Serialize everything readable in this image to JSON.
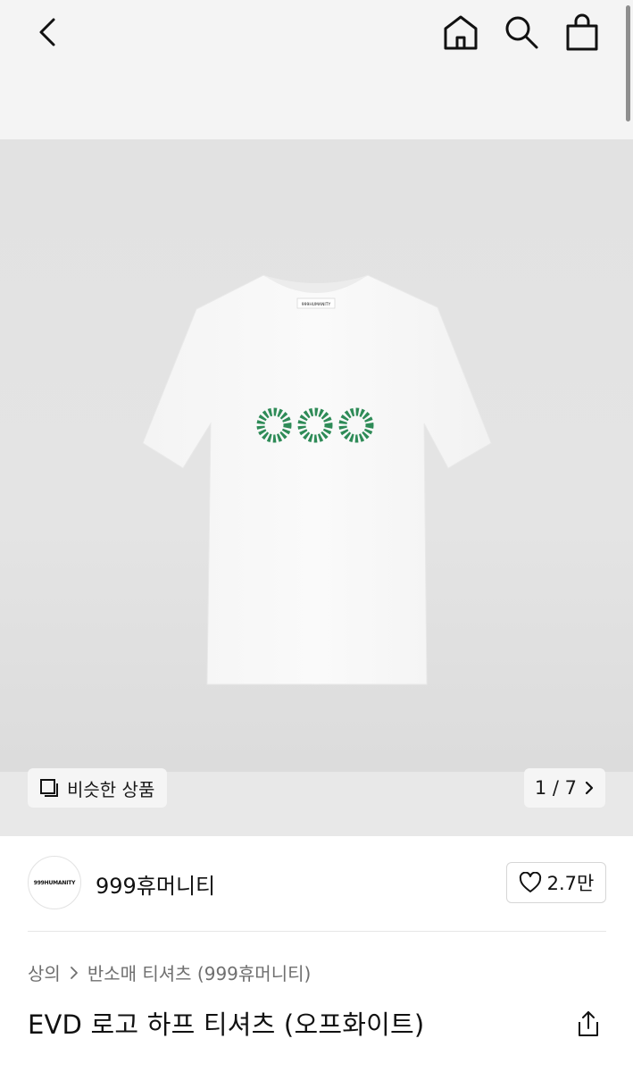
{
  "header": {
    "icons": [
      "chevron-left-icon",
      "home-icon",
      "search-icon",
      "shopping-bag-icon"
    ]
  },
  "gallery": {
    "similar_label": "비슷한 상품",
    "counter": "1 / 7",
    "shirt_tag_text": "999HUMANITY"
  },
  "brand": {
    "logo_text": "999HUMANITY",
    "name": "999휴머니티",
    "likes": "2.7만"
  },
  "breadcrumb": {
    "category": "상의",
    "subcategory": "반소매 티셔츠 (999휴머니티)"
  },
  "product": {
    "title": "EVD 로고 하프 티셔츠 (오프화이트)"
  },
  "colors": {
    "header_bg": "#f4f4f4",
    "emblem_green": "#2e8b57",
    "text": "#111111",
    "muted": "#6f6f6f"
  }
}
